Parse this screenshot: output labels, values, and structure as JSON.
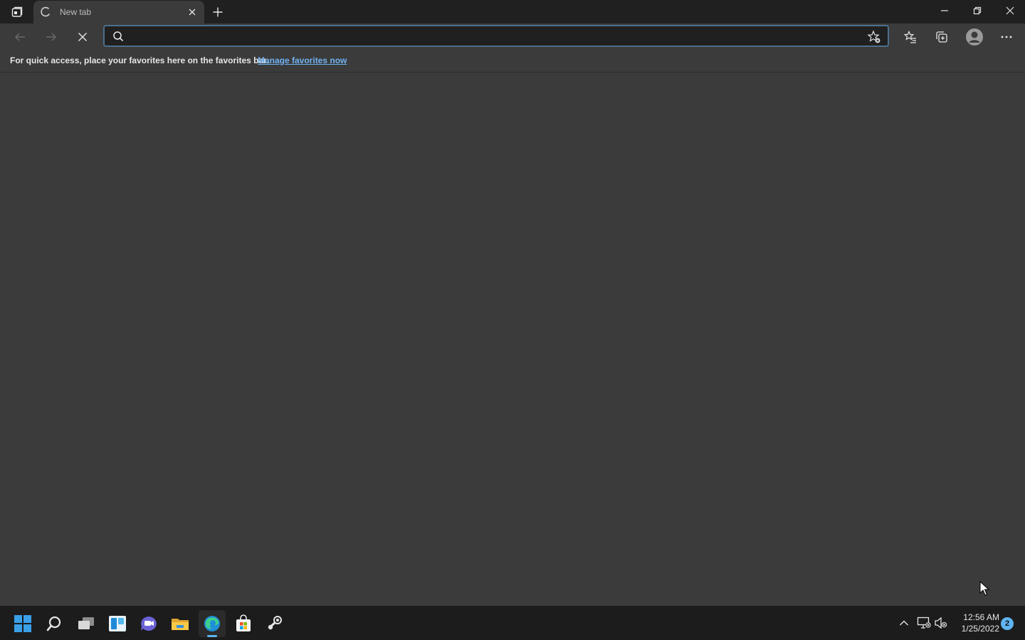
{
  "browser": {
    "tab": {
      "title": "New tab",
      "state": "loading"
    },
    "address_bar": {
      "value": "",
      "placeholder": ""
    },
    "favorites_bar": {
      "hint": "For quick access, place your favorites here on the favorites bar.",
      "manage_link": "Manage favorites now"
    },
    "icons": {
      "tab_actions": "tab-actions-icon",
      "new_tab": "plus-icon",
      "back": "back-arrow-icon",
      "forward": "forward-arrow-icon",
      "stop": "stop-icon",
      "search": "search-icon",
      "add_favorite": "star-add-icon",
      "favorites": "favorites-icon",
      "collections": "collections-icon",
      "profile": "profile-icon",
      "more": "more-icon"
    }
  },
  "taskbar": {
    "apps": [
      "start",
      "search",
      "task-view",
      "widgets",
      "teams-chat",
      "file-explorer",
      "edge",
      "store",
      "steam"
    ],
    "active_app": "edge",
    "clock": {
      "time": "12:56 AM",
      "date": "1/25/2022"
    },
    "notification_count": "2"
  },
  "colors": {
    "titlebar": "#202020",
    "content_bg": "#3b3b3b",
    "link": "#6fb2f2",
    "taskbar": "#1c1c1c",
    "accent": "#5fb4f0"
  }
}
